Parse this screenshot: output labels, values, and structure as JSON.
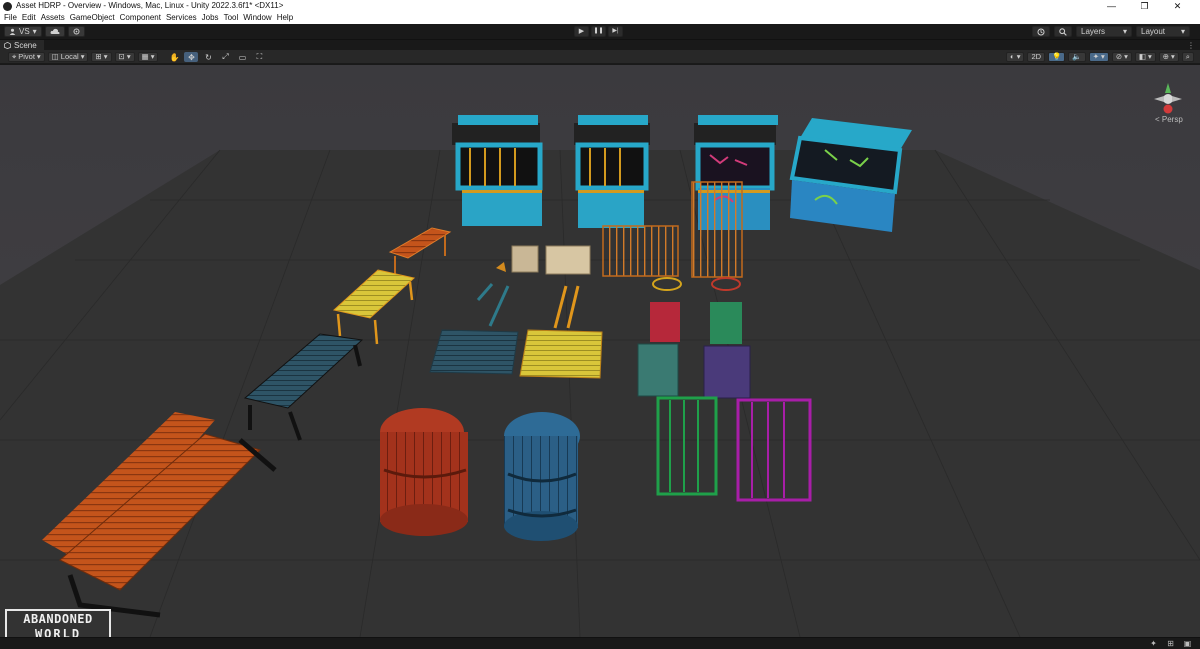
{
  "window": {
    "title": "Asset HDRP - Overview - Windows, Mac, Linux - Unity 2022.3.6f1* <DX11>",
    "minimize": "—",
    "maximize": "❐",
    "close": "✕"
  },
  "menu": [
    "File",
    "Edit",
    "Assets",
    "GameObject",
    "Component",
    "Services",
    "Jobs",
    "Tool",
    "Window",
    "Help"
  ],
  "toolbar": {
    "account_label": "VS",
    "layers_label": "Layers",
    "layout_label": "Layout",
    "play_icon": "▶",
    "pause_icon": "❚❚",
    "step_icon": "▶|"
  },
  "scene_tab": {
    "label": "Scene"
  },
  "scene_toolbar": {
    "pivot_label": "Pivot",
    "local_label": "Local",
    "mode_2d_label": "2D"
  },
  "gizmo": {
    "projection_label": "< Persp"
  },
  "logo": {
    "line1": "ABANDONED",
    "line2": "WORLD"
  },
  "colors": {
    "editor_bg": "#191919",
    "scene_bg": "#3a3a3c",
    "ground": "#333333",
    "accent": "#46607c"
  }
}
